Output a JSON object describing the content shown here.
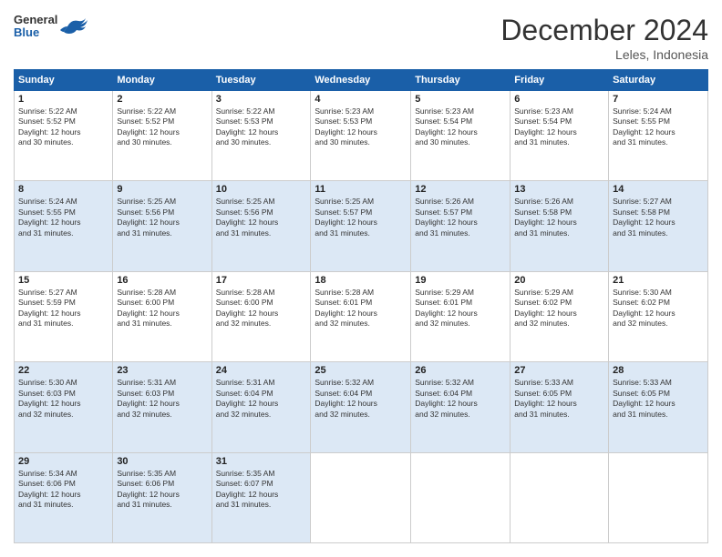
{
  "header": {
    "logo_general": "General",
    "logo_blue": "Blue",
    "month_title": "December 2024",
    "location": "Leles, Indonesia"
  },
  "weekdays": [
    "Sunday",
    "Monday",
    "Tuesday",
    "Wednesday",
    "Thursday",
    "Friday",
    "Saturday"
  ],
  "weeks": [
    [
      {
        "day": "1",
        "sunrise": "5:22 AM",
        "sunset": "5:52 PM",
        "daylight": "12 hours and 30 minutes."
      },
      {
        "day": "2",
        "sunrise": "5:22 AM",
        "sunset": "5:52 PM",
        "daylight": "12 hours and 30 minutes."
      },
      {
        "day": "3",
        "sunrise": "5:22 AM",
        "sunset": "5:53 PM",
        "daylight": "12 hours and 30 minutes."
      },
      {
        "day": "4",
        "sunrise": "5:23 AM",
        "sunset": "5:53 PM",
        "daylight": "12 hours and 30 minutes."
      },
      {
        "day": "5",
        "sunrise": "5:23 AM",
        "sunset": "5:54 PM",
        "daylight": "12 hours and 30 minutes."
      },
      {
        "day": "6",
        "sunrise": "5:23 AM",
        "sunset": "5:54 PM",
        "daylight": "12 hours and 31 minutes."
      },
      {
        "day": "7",
        "sunrise": "5:24 AM",
        "sunset": "5:55 PM",
        "daylight": "12 hours and 31 minutes."
      }
    ],
    [
      {
        "day": "8",
        "sunrise": "5:24 AM",
        "sunset": "5:55 PM",
        "daylight": "12 hours and 31 minutes."
      },
      {
        "day": "9",
        "sunrise": "5:25 AM",
        "sunset": "5:56 PM",
        "daylight": "12 hours and 31 minutes."
      },
      {
        "day": "10",
        "sunrise": "5:25 AM",
        "sunset": "5:56 PM",
        "daylight": "12 hours and 31 minutes."
      },
      {
        "day": "11",
        "sunrise": "5:25 AM",
        "sunset": "5:57 PM",
        "daylight": "12 hours and 31 minutes."
      },
      {
        "day": "12",
        "sunrise": "5:26 AM",
        "sunset": "5:57 PM",
        "daylight": "12 hours and 31 minutes."
      },
      {
        "day": "13",
        "sunrise": "5:26 AM",
        "sunset": "5:58 PM",
        "daylight": "12 hours and 31 minutes."
      },
      {
        "day": "14",
        "sunrise": "5:27 AM",
        "sunset": "5:58 PM",
        "daylight": "12 hours and 31 minutes."
      }
    ],
    [
      {
        "day": "15",
        "sunrise": "5:27 AM",
        "sunset": "5:59 PM",
        "daylight": "12 hours and 31 minutes."
      },
      {
        "day": "16",
        "sunrise": "5:28 AM",
        "sunset": "6:00 PM",
        "daylight": "12 hours and 31 minutes."
      },
      {
        "day": "17",
        "sunrise": "5:28 AM",
        "sunset": "6:00 PM",
        "daylight": "12 hours and 32 minutes."
      },
      {
        "day": "18",
        "sunrise": "5:28 AM",
        "sunset": "6:01 PM",
        "daylight": "12 hours and 32 minutes."
      },
      {
        "day": "19",
        "sunrise": "5:29 AM",
        "sunset": "6:01 PM",
        "daylight": "12 hours and 32 minutes."
      },
      {
        "day": "20",
        "sunrise": "5:29 AM",
        "sunset": "6:02 PM",
        "daylight": "12 hours and 32 minutes."
      },
      {
        "day": "21",
        "sunrise": "5:30 AM",
        "sunset": "6:02 PM",
        "daylight": "12 hours and 32 minutes."
      }
    ],
    [
      {
        "day": "22",
        "sunrise": "5:30 AM",
        "sunset": "6:03 PM",
        "daylight": "12 hours and 32 minutes."
      },
      {
        "day": "23",
        "sunrise": "5:31 AM",
        "sunset": "6:03 PM",
        "daylight": "12 hours and 32 minutes."
      },
      {
        "day": "24",
        "sunrise": "5:31 AM",
        "sunset": "6:04 PM",
        "daylight": "12 hours and 32 minutes."
      },
      {
        "day": "25",
        "sunrise": "5:32 AM",
        "sunset": "6:04 PM",
        "daylight": "12 hours and 32 minutes."
      },
      {
        "day": "26",
        "sunrise": "5:32 AM",
        "sunset": "6:04 PM",
        "daylight": "12 hours and 32 minutes."
      },
      {
        "day": "27",
        "sunrise": "5:33 AM",
        "sunset": "6:05 PM",
        "daylight": "12 hours and 31 minutes."
      },
      {
        "day": "28",
        "sunrise": "5:33 AM",
        "sunset": "6:05 PM",
        "daylight": "12 hours and 31 minutes."
      }
    ],
    [
      {
        "day": "29",
        "sunrise": "5:34 AM",
        "sunset": "6:06 PM",
        "daylight": "12 hours and 31 minutes."
      },
      {
        "day": "30",
        "sunrise": "5:35 AM",
        "sunset": "6:06 PM",
        "daylight": "12 hours and 31 minutes."
      },
      {
        "day": "31",
        "sunrise": "5:35 AM",
        "sunset": "6:07 PM",
        "daylight": "12 hours and 31 minutes."
      },
      null,
      null,
      null,
      null
    ]
  ],
  "labels": {
    "sunrise": "Sunrise:",
    "sunset": "Sunset:",
    "daylight": "Daylight:"
  }
}
